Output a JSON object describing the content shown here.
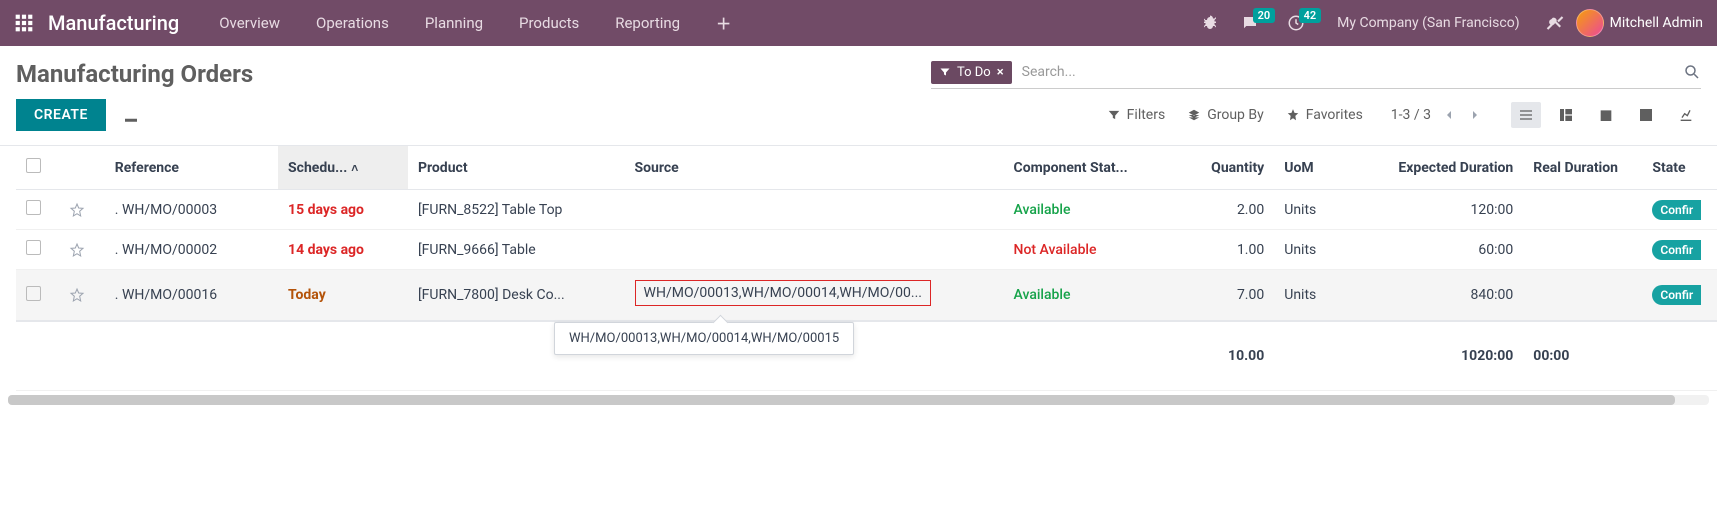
{
  "topbar": {
    "brand": "Manufacturing",
    "nav": [
      "Overview",
      "Operations",
      "Planning",
      "Products",
      "Reporting"
    ],
    "badges": {
      "messages": "20",
      "activities": "42"
    },
    "company": "My Company (San Francisco)",
    "user": "Mitchell Admin"
  },
  "page": {
    "title": "Manufacturing Orders",
    "create": "CREATE",
    "search_placeholder": "Search...",
    "filter_tag": "To Do",
    "filters": "Filters",
    "groupby": "Group By",
    "favorites": "Favorites",
    "pager": "1-3 / 3"
  },
  "columns": {
    "reference": "Reference",
    "scheduled": "Schedu...",
    "product": "Product",
    "source": "Source",
    "component": "Component Stat...",
    "quantity": "Quantity",
    "uom": "UoM",
    "expected": "Expected Duration",
    "real": "Real Duration",
    "state": "State"
  },
  "rows": [
    {
      "reference": ". WH/MO/00003",
      "scheduled": "15 days ago",
      "sched_class": "sched-overdue",
      "product": "[FURN_8522] Table Top",
      "source": "",
      "component": "Available",
      "comp_class": "comp-available",
      "quantity": "2.00",
      "uom": "Units",
      "expected": "120:00",
      "real": "",
      "state": "Confir"
    },
    {
      "reference": ". WH/MO/00002",
      "scheduled": "14 days ago",
      "sched_class": "sched-overdue",
      "product": "[FURN_9666] Table",
      "source": "",
      "component": "Not Available",
      "comp_class": "comp-notavailable",
      "quantity": "1.00",
      "uom": "Units",
      "expected": "60:00",
      "real": "",
      "state": "Confir"
    },
    {
      "reference": ". WH/MO/00016",
      "scheduled": "Today",
      "sched_class": "sched-today",
      "product": "[FURN_7800] Desk Co...",
      "source": "WH/MO/00013,WH/MO/00014,WH/MO/00...",
      "source_boxed": true,
      "component": "Available",
      "comp_class": "comp-available",
      "quantity": "7.00",
      "uom": "Units",
      "expected": "840:00",
      "real": "",
      "state": "Confir",
      "highlight": true
    }
  ],
  "tooltip": "WH/MO/00013,WH/MO/00014,WH/MO/00015",
  "totals": {
    "quantity": "10.00",
    "expected": "1020:00",
    "real": "00:00"
  }
}
